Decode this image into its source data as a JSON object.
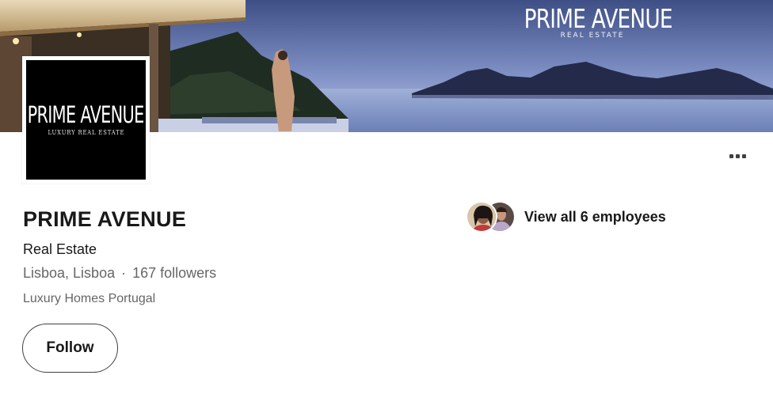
{
  "cover": {
    "brand_title": "PRIME AVENUE",
    "brand_subtitle": "REAL ESTATE"
  },
  "logo": {
    "title": "PRIME AVENUE",
    "subtitle": "LUXURY REAL ESTATE"
  },
  "company": {
    "name": "PRIME AVENUE",
    "industry": "Real Estate",
    "location": "Lisboa, Lisboa",
    "separator": "·",
    "followers": "167 followers",
    "tagline": "Luxury Homes Portugal"
  },
  "actions": {
    "follow_label": "Follow",
    "more_icon": "ellipsis-icon"
  },
  "employees": {
    "label": "View all 6 employees"
  },
  "colors": {
    "text_primary": "#191919",
    "text_secondary": "#666666",
    "button_border": "#404040"
  }
}
